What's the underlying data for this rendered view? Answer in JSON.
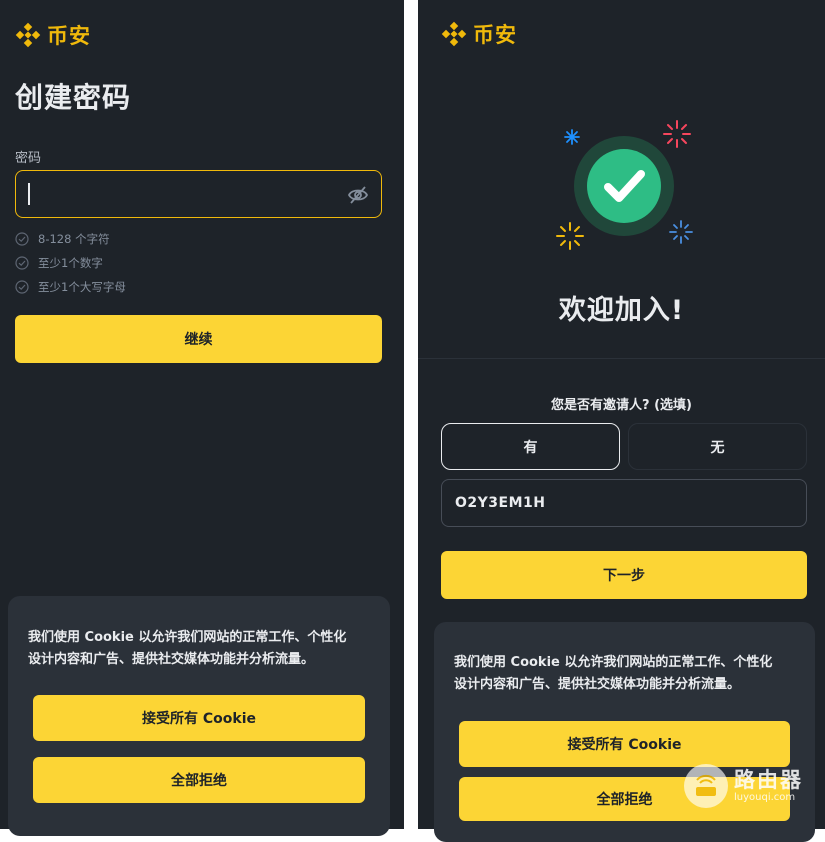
{
  "colors": {
    "accent": "#fcd535",
    "brand": "#f0b90b",
    "background": "#1e2329",
    "success": "#2ebd85"
  },
  "left": {
    "logo_text": "币安",
    "title": "创建密码",
    "password_label": "密码",
    "password_value": "",
    "rules": [
      "8-128 个字符",
      "至少1个数字",
      "至少1个大写字母"
    ],
    "continue_label": "继续",
    "cookie": {
      "line1": "我们使用 Cookie 以允许我们网站的正常工作、个性化",
      "line2": "设计内容和广告、提供社交媒体功能并分析流量。",
      "accept_label": "接受所有 Cookie",
      "reject_label": "全部拒绝"
    }
  },
  "right": {
    "logo_text": "币安",
    "welcome": "欢迎加入!",
    "referral_question": "您是否有邀请人? (选填)",
    "option_yes": "有",
    "option_no": "无",
    "selected_option": "有",
    "referral_code": "O2Y3EM1H",
    "next_label": "下一步",
    "cookie": {
      "line1": "我们使用 Cookie 以允许我们网站的正常工作、个性化",
      "line2": "设计内容和广告、提供社交媒体功能并分析流量。",
      "accept_label": "接受所有 Cookie",
      "reject_label": "全部拒绝"
    }
  },
  "watermark": {
    "title": "路由器",
    "domain": "luyouqi.com"
  }
}
